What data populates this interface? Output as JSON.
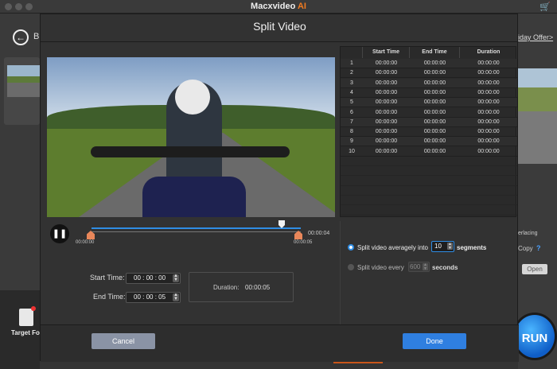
{
  "app": {
    "title": "Macxvideo",
    "title_suffix": "AI",
    "cart_icon": "cart-icon"
  },
  "background": {
    "back_letter": "B",
    "offer_text": "iday Offer>",
    "interlacing": "erlacing",
    "copy": "Copy",
    "help": "?",
    "open": "Open",
    "run": "RUN",
    "target_label": "Target Fo"
  },
  "modal": {
    "title": "Split Video",
    "timeline": {
      "start": "00:00:00",
      "end": "00:00:05",
      "current": "00:00:04",
      "playhead_fraction": 0.92
    },
    "start_time_label": "Start Time:",
    "end_time_label": "End Time:",
    "start_time": "00 : 00 : 00",
    "end_time": "00 : 00 : 05",
    "duration_label": "Duration:",
    "duration_value": "00:00:05",
    "table": {
      "headers": [
        "",
        "Start Time",
        "End Time",
        "Duration"
      ],
      "rows": [
        [
          "1",
          "00:00:00",
          "00:00:00",
          "00:00:00"
        ],
        [
          "2",
          "00:00:00",
          "00:00:00",
          "00:00:00"
        ],
        [
          "3",
          "00:00:00",
          "00:00:00",
          "00:00:00"
        ],
        [
          "4",
          "00:00:00",
          "00:00:00",
          "00:00:00"
        ],
        [
          "5",
          "00:00:00",
          "00:00:00",
          "00:00:00"
        ],
        [
          "6",
          "00:00:00",
          "00:00:00",
          "00:00:00"
        ],
        [
          "7",
          "00:00:00",
          "00:00:00",
          "00:00:00"
        ],
        [
          "8",
          "00:00:00",
          "00:00:00",
          "00:00:00"
        ],
        [
          "9",
          "00:00:00",
          "00:00:00",
          "00:00:00"
        ],
        [
          "10",
          "00:00:00",
          "00:00:00",
          "00:00:00"
        ]
      ]
    },
    "split_option_1": "Split video averagely into",
    "segments_value": "10",
    "segments_label": "segments",
    "split_option_2": "Split video every",
    "seconds_value": "600",
    "seconds_label": "seconds",
    "cancel": "Cancel",
    "done": "Done"
  },
  "colors": {
    "accent": "#2f8de4",
    "orange": "#e9875a",
    "brand": "#f07a20"
  }
}
